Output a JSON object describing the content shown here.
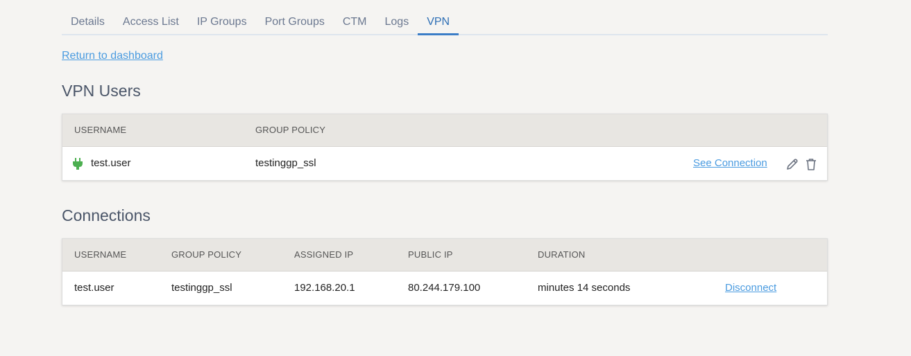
{
  "tabs": [
    {
      "label": "Details",
      "active": false
    },
    {
      "label": "Access List",
      "active": false
    },
    {
      "label": "IP Groups",
      "active": false
    },
    {
      "label": "Port Groups",
      "active": false
    },
    {
      "label": "CTM",
      "active": false
    },
    {
      "label": "Logs",
      "active": false
    },
    {
      "label": "VPN",
      "active": true
    }
  ],
  "return_link": "Return to dashboard",
  "vpn_users": {
    "title": "VPN Users",
    "columns": [
      "USERNAME",
      "GROUP POLICY"
    ],
    "rows": [
      {
        "status_icon": "plug-icon",
        "status_color": "#4caf50",
        "username": "test.user",
        "group_policy": "testinggp_ssl",
        "action_label": "See Connection",
        "edit_icon": "pencil-icon",
        "delete_icon": "trash-icon"
      }
    ]
  },
  "connections": {
    "title": "Connections",
    "columns": [
      "USERNAME",
      "GROUP POLICY",
      "ASSIGNED IP",
      "PUBLIC IP",
      "DURATION"
    ],
    "rows": [
      {
        "username": "test.user",
        "group_policy": "testinggp_ssl",
        "assigned_ip": "192.168.20.1",
        "public_ip": "80.244.179.100",
        "duration": "minutes 14 seconds",
        "action_label": "Disconnect"
      }
    ]
  }
}
